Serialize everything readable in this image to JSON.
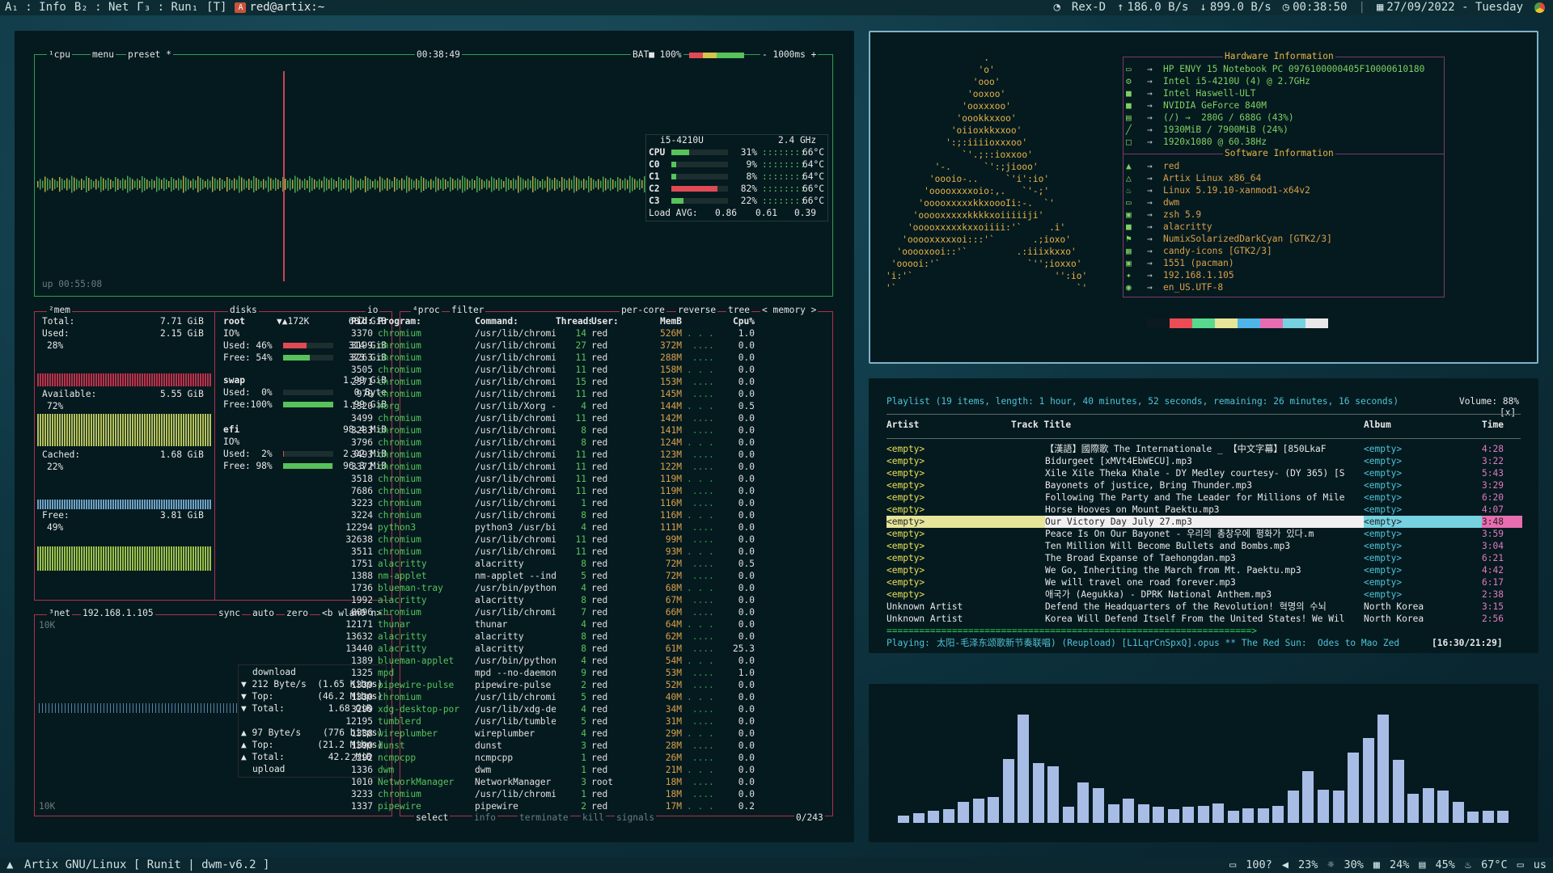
{
  "topbar": {
    "workspaces": [
      "A₁ : Info",
      "B₂ : Net",
      "Γ₃ : Run₁",
      "[T]"
    ],
    "window_title": "red@artix:~",
    "wifi": "Rex-D",
    "upload_rate": "186.0 B/s",
    "download_rate": "899.0 B/s",
    "uptime": "00:38:50",
    "date": "27/09/2022 - Tuesday"
  },
  "bottombar": {
    "left": "Artix GNU/Linux [ Runit | dwm-v6.2 ]",
    "battery": "100?",
    "volume": "23%",
    "brightness": "30%",
    "cpu": "24%",
    "disk": "45%",
    "temp": "67°C",
    "layout": "us"
  },
  "btop": {
    "cpu_box": {
      "tabs": [
        "¹cpu",
        "menu",
        "preset *"
      ],
      "clock": "00:38:49",
      "battery": "BAT■ 100%",
      "refresh": "- 1000ms +",
      "uptime": "up 00:55:08",
      "model": "i5-4210U",
      "freq": "2.4 GHz",
      "cores": [
        {
          "name": "CPU",
          "pct": "31%",
          "temp": "66°C",
          "fill": 0.31
        },
        {
          "name": "C0",
          "pct": "9%",
          "temp": "64°C",
          "fill": 0.09
        },
        {
          "name": "C1",
          "pct": "8%",
          "temp": "64°C",
          "fill": 0.08
        },
        {
          "name": "C2",
          "pct": "82%",
          "temp": "66°C",
          "fill": 0.82
        },
        {
          "name": "C3",
          "pct": "22%",
          "temp": "66°C",
          "fill": 0.22
        }
      ],
      "load_label": "Load AVG:",
      "load": [
        "0.86",
        "0.61",
        "0.39"
      ]
    },
    "mem_box": {
      "title": "²mem",
      "total_label": "Total:",
      "total": "7.71 GiB",
      "used_label": "Used:",
      "used": "2.15 GiB",
      "used_pct": "28%",
      "avail_label": "Available:",
      "avail": "5.55 GiB",
      "avail_pct": "72%",
      "cached_label": "Cached:",
      "cached": "1.68 GiB",
      "cached_pct": "22%",
      "free_label": "Free:",
      "free": "3.81 GiB",
      "free_pct": "49%"
    },
    "disks_box": {
      "title": "disks",
      "io": "io",
      "disks": [
        {
          "name": "root",
          "extra": "▼▲172K",
          "size": "687 GiB",
          "io": "IO%",
          "used_label": "Used: 46%",
          "used": "314 GiB",
          "used_fill": 0.46,
          "free_label": "Free: 54%",
          "free": "373 GiB",
          "free_fill": 0.54
        },
        {
          "name": "swap",
          "extra": "",
          "size": "1.99 GiB",
          "io": "",
          "used_label": "Used:  0%",
          "used": "0 Byte",
          "used_fill": 0.0,
          "free_label": "Free:100%",
          "free": "1.99 GiB",
          "free_fill": 1.0
        },
        {
          "name": "efi",
          "extra": "",
          "size": "98.4 MiB",
          "io": "IO%",
          "used_label": "Used:  2%",
          "used": "2.02 MiB",
          "used_fill": 0.02,
          "free_label": "Free: 98%",
          "free": "96.3 MiB",
          "free_fill": 0.98
        }
      ]
    },
    "net_box": {
      "title": "³net",
      "ip": "192.168.1.105",
      "opts": [
        "sync",
        "auto",
        "zero",
        "<b wlan0 n>"
      ],
      "top_scale": "10K",
      "bottom_scale": "10K",
      "download_label": "download",
      "upload_label": "upload",
      "down_rate": "▼ 212 Byte/s  (1.65 Kibps)",
      "down_top": "▼ Top:        (46.2 Mibps)",
      "down_total": "▼ Total:        1.68 GiB",
      "up_rate": "▲ 97 Byte/s    (776 bitps)",
      "up_top": "▲ Top:        (21.2 Mibps)",
      "up_total": "▲ Total:        42.2 MiB"
    },
    "proc_box": {
      "title": "⁴proc",
      "filter": "filter",
      "opts": [
        "per-core",
        "reverse",
        "tree",
        "< memory >"
      ],
      "headers": [
        "Pid:",
        "Program:",
        "Command:",
        "Threads:",
        "User:",
        "MemB",
        "",
        "Cpu%"
      ],
      "rows": [
        [
          "3370",
          "chromium",
          "/usr/lib/chromi",
          "14",
          "red",
          "526M",
          "1.0"
        ],
        [
          "3199",
          "chromium",
          "/usr/lib/chromi",
          "27",
          "red",
          "372M",
          "0.0"
        ],
        [
          "3263",
          "chromium",
          "/usr/lib/chromi",
          "11",
          "red",
          "288M",
          "0.0"
        ],
        [
          "3505",
          "chromium",
          "/usr/lib/chromi",
          "11",
          "red",
          "158M",
          "0.0"
        ],
        [
          "2371",
          "chromium",
          "/usr/lib/chromi",
          "15",
          "red",
          "153M",
          "0.0"
        ],
        [
          "970",
          "chromium",
          "/usr/lib/chromi",
          "11",
          "red",
          "145M",
          "0.0"
        ],
        [
          "1320",
          "Xorg",
          "/usr/lib/Xorg -",
          "4",
          "red",
          "144M",
          "0.5"
        ],
        [
          "3499",
          "chromium",
          "/usr/lib/chromi",
          "11",
          "red",
          "142M",
          "0.0"
        ],
        [
          "3283",
          "chromium",
          "/usr/lib/chromi",
          "8",
          "red",
          "141M",
          "0.0"
        ],
        [
          "3796",
          "chromium",
          "/usr/lib/chromi",
          "8",
          "red",
          "124M",
          "0.0"
        ],
        [
          "3493",
          "chromium",
          "/usr/lib/chromi",
          "11",
          "red",
          "123M",
          "0.0"
        ],
        [
          "3372",
          "chromium",
          "/usr/lib/chromi",
          "11",
          "red",
          "122M",
          "0.0"
        ],
        [
          "3518",
          "chromium",
          "/usr/lib/chromi",
          "11",
          "red",
          "119M",
          "0.0"
        ],
        [
          "7686",
          "chromium",
          "/usr/lib/chromi",
          "11",
          "red",
          "119M",
          "0.0"
        ],
        [
          "3223",
          "chromium",
          "/usr/lib/chromi",
          "1",
          "red",
          "116M",
          "0.0"
        ],
        [
          "3224",
          "chromium",
          "/usr/lib/chromi",
          "8",
          "red",
          "116M",
          "0.0"
        ],
        [
          "12294",
          "python3",
          "python3 /usr/bi",
          "4",
          "red",
          "111M",
          "0.0"
        ],
        [
          "32638",
          "chromium",
          "/usr/lib/chromi",
          "11",
          "red",
          "99M",
          "0.0"
        ],
        [
          "3511",
          "chromium",
          "/usr/lib/chromi",
          "11",
          "red",
          "93M",
          "0.0"
        ],
        [
          "1751",
          "alacritty",
          "alacritty",
          "8",
          "red",
          "72M",
          "0.5"
        ],
        [
          "1388",
          "nm-applet",
          "nm-applet --ind",
          "5",
          "red",
          "72M",
          "0.0"
        ],
        [
          "1736",
          "blueman-tray",
          "/usr/bin/python",
          "4",
          "red",
          "68M",
          "0.0"
        ],
        [
          "1992",
          "alacritty",
          "alacritty",
          "8",
          "red",
          "67M",
          "0.0"
        ],
        [
          "8096",
          "chromium",
          "/usr/lib/chromi",
          "7",
          "red",
          "66M",
          "0.0"
        ],
        [
          "12171",
          "thunar",
          "thunar",
          "4",
          "red",
          "64M",
          "0.0"
        ],
        [
          "13632",
          "alacritty",
          "alacritty",
          "8",
          "red",
          "62M",
          "0.0"
        ],
        [
          "13440",
          "alacritty",
          "alacritty",
          "8",
          "red",
          "61M",
          "25.3"
        ],
        [
          "1389",
          "blueman-applet",
          "/usr/bin/python",
          "4",
          "red",
          "54M",
          "0.0"
        ],
        [
          "1325",
          "mpd",
          "mpd --no-daemon",
          "9",
          "red",
          "53M",
          "1.0"
        ],
        [
          "1339",
          "pipewire-pulse",
          "pipewire-pulse",
          "2",
          "red",
          "52M",
          "0.0"
        ],
        [
          "1330",
          "chromium",
          "/usr/lib/chromi",
          "5",
          "red",
          "40M",
          "0.0"
        ],
        [
          "3299",
          "xdg-desktop-por",
          "/usr/lib/xdg-de",
          "4",
          "red",
          "34M",
          "0.0"
        ],
        [
          "12195",
          "tumblerd",
          "/usr/lib/tumble",
          "5",
          "red",
          "31M",
          "0.0"
        ],
        [
          "1338",
          "wireplumber",
          "wireplumber",
          "4",
          "red",
          "29M",
          "0.0"
        ],
        [
          "1390",
          "dunst",
          "dunst",
          "3",
          "red",
          "28M",
          "0.0"
        ],
        [
          "2292",
          "ncmpcpp",
          "ncmpcpp",
          "1",
          "red",
          "26M",
          "0.0"
        ],
        [
          "1336",
          "dwm",
          "dwm",
          "1",
          "red",
          "21M",
          "0.0"
        ],
        [
          "1010",
          "NetworkManager",
          "NetworkManager",
          "3",
          "root",
          "18M",
          "0.0"
        ],
        [
          "3233",
          "chromium",
          "/usr/lib/chromi",
          "1",
          "red",
          "18M",
          "0.0"
        ],
        [
          "1337",
          "pipewire",
          "pipewire",
          "2",
          "red",
          "17M",
          "0.2"
        ]
      ],
      "footer_select": "select",
      "footer_info": "info",
      "footer_terminate": "terminate",
      "footer_kill": "kill",
      "footer_signals": "signals",
      "count": "0/243"
    }
  },
  "neofetch": {
    "hw_header": "Hardware Information",
    "sw_header": "Software Information",
    "hw": [
      {
        "icon": "laptop-icon",
        "glyph": "▭",
        "value": "HP ENVY 15 Notebook PC 0976100000405F10000610180"
      },
      {
        "icon": "cpu-icon",
        "glyph": "⚙",
        "value": "Intel i5-4210U (4) @ 2.7GHz"
      },
      {
        "icon": "gpu-icon",
        "glyph": "■",
        "value": "Intel Haswell-ULT"
      },
      {
        "icon": "gpu-icon",
        "glyph": "■",
        "value": "NVIDIA GeForce 840M"
      },
      {
        "icon": "disk-icon",
        "glyph": "▤",
        "value": "(/) →  280G / 688G (43%)"
      },
      {
        "icon": "memory-icon",
        "glyph": "╱",
        "value": "1930MiB / 7900MiB (24%)"
      },
      {
        "icon": "monitor-icon",
        "glyph": "□",
        "value": "1920x1080 @ 60.38Hz"
      }
    ],
    "sw": [
      {
        "icon": "user-icon",
        "glyph": "▲",
        "value": "red"
      },
      {
        "icon": "os-icon",
        "glyph": "△",
        "value": "Artix Linux x86_64"
      },
      {
        "icon": "kernel-icon",
        "glyph": "♨",
        "value": "Linux 5.19.10-xanmod1-x64v2"
      },
      {
        "icon": "wm-icon",
        "glyph": "▭",
        "value": "dwm"
      },
      {
        "icon": "shell-icon",
        "glyph": "▣",
        "value": "zsh 5.9"
      },
      {
        "icon": "terminal-icon",
        "glyph": "■",
        "value": "alacritty"
      },
      {
        "icon": "theme-icon",
        "glyph": "⚑",
        "value": "NumixSolarizedDarkCyan [GTK2/3]"
      },
      {
        "icon": "icons-icon",
        "glyph": "▦",
        "value": "candy-icons [GTK2/3]"
      },
      {
        "icon": "package-icon",
        "glyph": "▣",
        "value": "1551 (pacman)"
      },
      {
        "icon": "network-icon",
        "glyph": "✦",
        "value": "192.168.1.105"
      },
      {
        "icon": "locale-icon",
        "glyph": "◉",
        "value": "en_US.UTF-8"
      }
    ],
    "palette": [
      "#0b1a20",
      "#ee4c55",
      "#57d98e",
      "#e6e59a",
      "#4fb5e8",
      "#e86db0",
      "#76d1e0",
      "#e8e8e8"
    ]
  },
  "ncmpcpp": {
    "header": "Playlist (19 items, length: 1 hour, 40 minutes, 52 seconds, remaining: 26 minutes, 16 seconds)",
    "volume": "Volume: 88%",
    "close": "[x]",
    "columns": {
      "artist": "Artist",
      "track": "Track Title",
      "album": "Album",
      "time": "Time"
    },
    "tracks": [
      [
        "<empty>",
        "【漢語】國際歌 The Internationale _ 【中文字幕】[850LkaF",
        "<empty>",
        "4:28"
      ],
      [
        "<empty>",
        "Bidurgeet [xMVt4EbWECU].mp3",
        "<empty>",
        "3:22"
      ],
      [
        "<empty>",
        "Xile Xile Theka Khale - DY Medley courtesy- (DY 365) [S",
        "<empty>",
        "5:43"
      ],
      [
        "<empty>",
        "Bayonets of justice, Bring Thunder.mp3",
        "<empty>",
        "3:29"
      ],
      [
        "<empty>",
        "Following The Party and The Leader for Millions of Mile",
        "<empty>",
        "6:20"
      ],
      [
        "<empty>",
        "Horse Hooves on Mount Paektu.mp3",
        "<empty>",
        "4:07"
      ],
      [
        "<empty>",
        "Our Victory Day July 27.mp3",
        "<empty>",
        "3:48"
      ],
      [
        "<empty>",
        "Peace Is On Our Bayonet - 우리의 총창우에 평화가 있다.m",
        "<empty>",
        "3:59"
      ],
      [
        "<empty>",
        "Ten Million Will Become Bullets and Bombs.mp3",
        "<empty>",
        "3:04"
      ],
      [
        "<empty>",
        "The Broad Expanse of Taehongdan.mp3",
        "<empty>",
        "6:21"
      ],
      [
        "<empty>",
        "We Go, Inheriting the March from Mt. Paektu.mp3",
        "<empty>",
        "4:42"
      ],
      [
        "<empty>",
        "We will travel one road forever.mp3",
        "<empty>",
        "6:17"
      ],
      [
        "<empty>",
        "애국가 (Aegukka) - DPRK National Anthem.mp3",
        "<empty>",
        "2:38"
      ],
      [
        "Unknown Artist",
        "Defend the Headquarters of the Revolution! 혁명의 수뇌",
        "North Korea",
        "3:15"
      ],
      [
        "Unknown Artist",
        "Korea Will Defend Itself From the United States! We Wil",
        "North Korea",
        "2:56"
      ]
    ],
    "selected_index": 6,
    "progress": "===================================================================>",
    "playing_label": "Playing:",
    "playing": "太阳-毛泽东颂歌新节奏联唱) (Reupload) [L1LqrCnSpxQ].opus ** The Red Sun:  Odes to Mao Zed",
    "playing_time": "[16:30/21:29]"
  },
  "visualizer": {
    "color": "#a8bde6",
    "levels": [
      0.06,
      0.08,
      0.1,
      0.11,
      0.17,
      0.2,
      0.21,
      0.52,
      0.88,
      0.49,
      0.46,
      0.13,
      0.33,
      0.28,
      0.15,
      0.2,
      0.15,
      0.13,
      0.11,
      0.13,
      0.14,
      0.16,
      0.1,
      0.12,
      0.12,
      0.14,
      0.26,
      0.42,
      0.27,
      0.26,
      0.57,
      0.69,
      0.88,
      0.51,
      0.24,
      0.28,
      0.26,
      0.17,
      0.09,
      0.1,
      0.1
    ]
  }
}
